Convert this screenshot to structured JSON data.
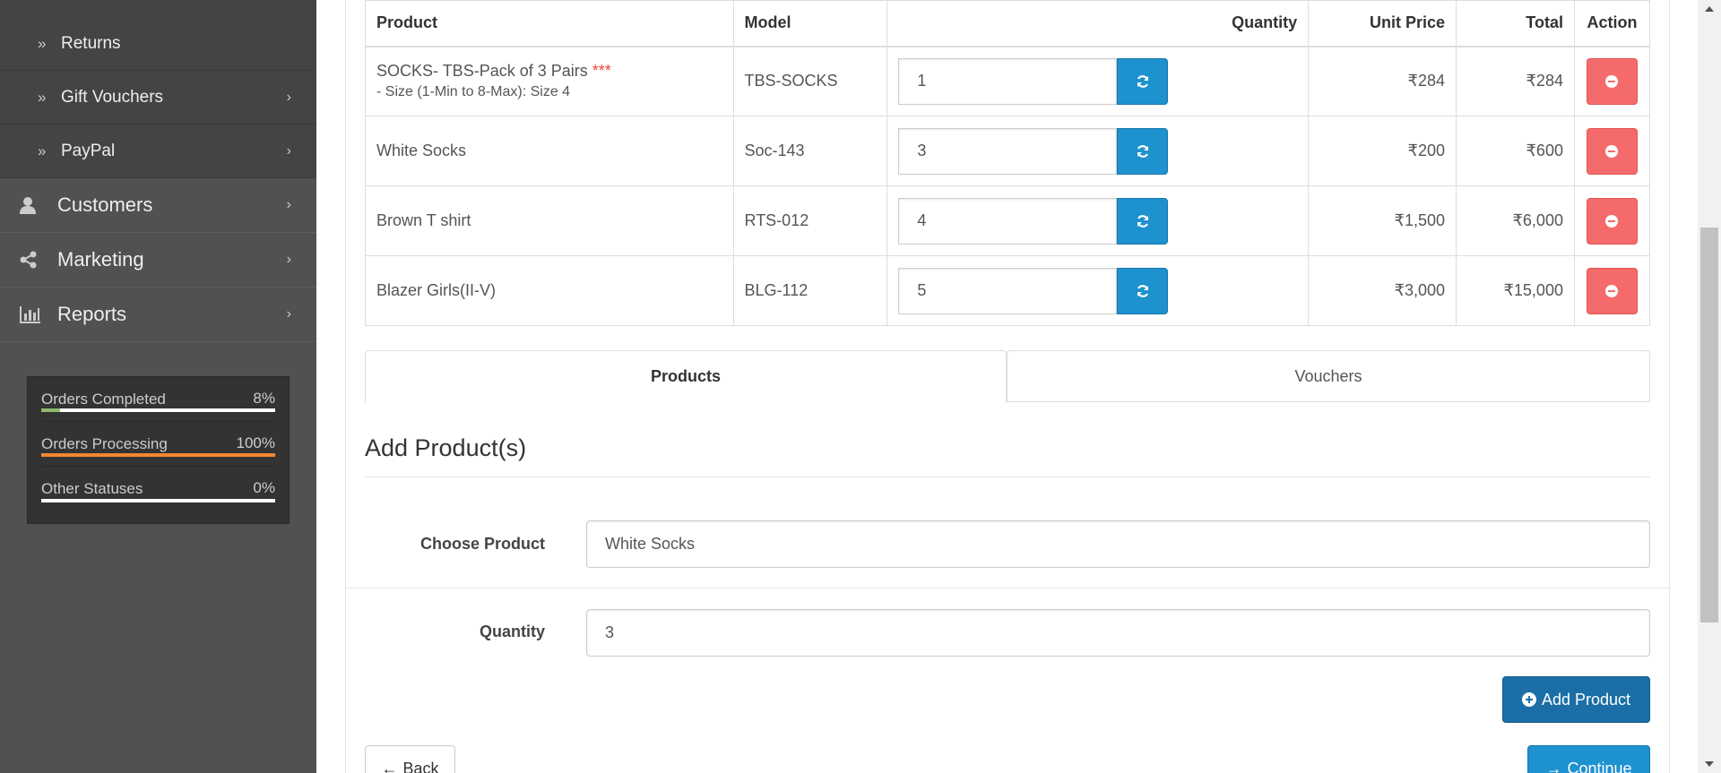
{
  "sidebar": {
    "sub_items": [
      {
        "label": "Returns",
        "has_children": false
      },
      {
        "label": "Gift Vouchers",
        "has_children": true
      },
      {
        "label": "PayPal",
        "has_children": true
      }
    ],
    "main_items": [
      {
        "label": "Customers",
        "icon": "user-icon"
      },
      {
        "label": "Marketing",
        "icon": "share-icon"
      },
      {
        "label": "Reports",
        "icon": "bar-chart-icon"
      }
    ],
    "stats": [
      {
        "label": "Orders Completed",
        "percent": "8%",
        "value": 8,
        "color": "#8fbb6c"
      },
      {
        "label": "Orders Processing",
        "percent": "100%",
        "value": 100,
        "color": "#f38733"
      },
      {
        "label": "Other Statuses",
        "percent": "0%",
        "value": 0,
        "color": "#ffffff"
      }
    ]
  },
  "cart": {
    "headers": {
      "product": "Product",
      "model": "Model",
      "quantity": "Quantity",
      "unit_price": "Unit Price",
      "total": "Total",
      "action": "Action"
    },
    "rows": [
      {
        "product": "SOCKS- TBS-Pack of 3 Pairs",
        "required_mark": "***",
        "option": "- Size (1-Min to 8-Max): Size 4",
        "model": "TBS-SOCKS",
        "quantity": "1",
        "unit_price": "₹284",
        "total": "₹284"
      },
      {
        "product": "White Socks",
        "required_mark": "",
        "option": "",
        "model": "Soc-143",
        "quantity": "3",
        "unit_price": "₹200",
        "total": "₹600"
      },
      {
        "product": "Brown T shirt",
        "required_mark": "",
        "option": "",
        "model": "RTS-012",
        "quantity": "4",
        "unit_price": "₹1,500",
        "total": "₹6,000"
      },
      {
        "product": "Blazer Girls(II-V)",
        "required_mark": "",
        "option": "",
        "model": "BLG-112",
        "quantity": "5",
        "unit_price": "₹3,000",
        "total": "₹15,000"
      }
    ]
  },
  "tabs": {
    "products": "Products",
    "vouchers": "Vouchers"
  },
  "add_product": {
    "legend": "Add Product(s)",
    "choose_label": "Choose Product",
    "choose_value": "White Socks",
    "quantity_label": "Quantity",
    "quantity_value": "3",
    "button": "Add Product"
  },
  "footer": {
    "back": "Back",
    "continue": "Continue"
  },
  "colors": {
    "primary": "#1e91cf",
    "danger": "#f56b6b",
    "sidebar": "#515151"
  }
}
